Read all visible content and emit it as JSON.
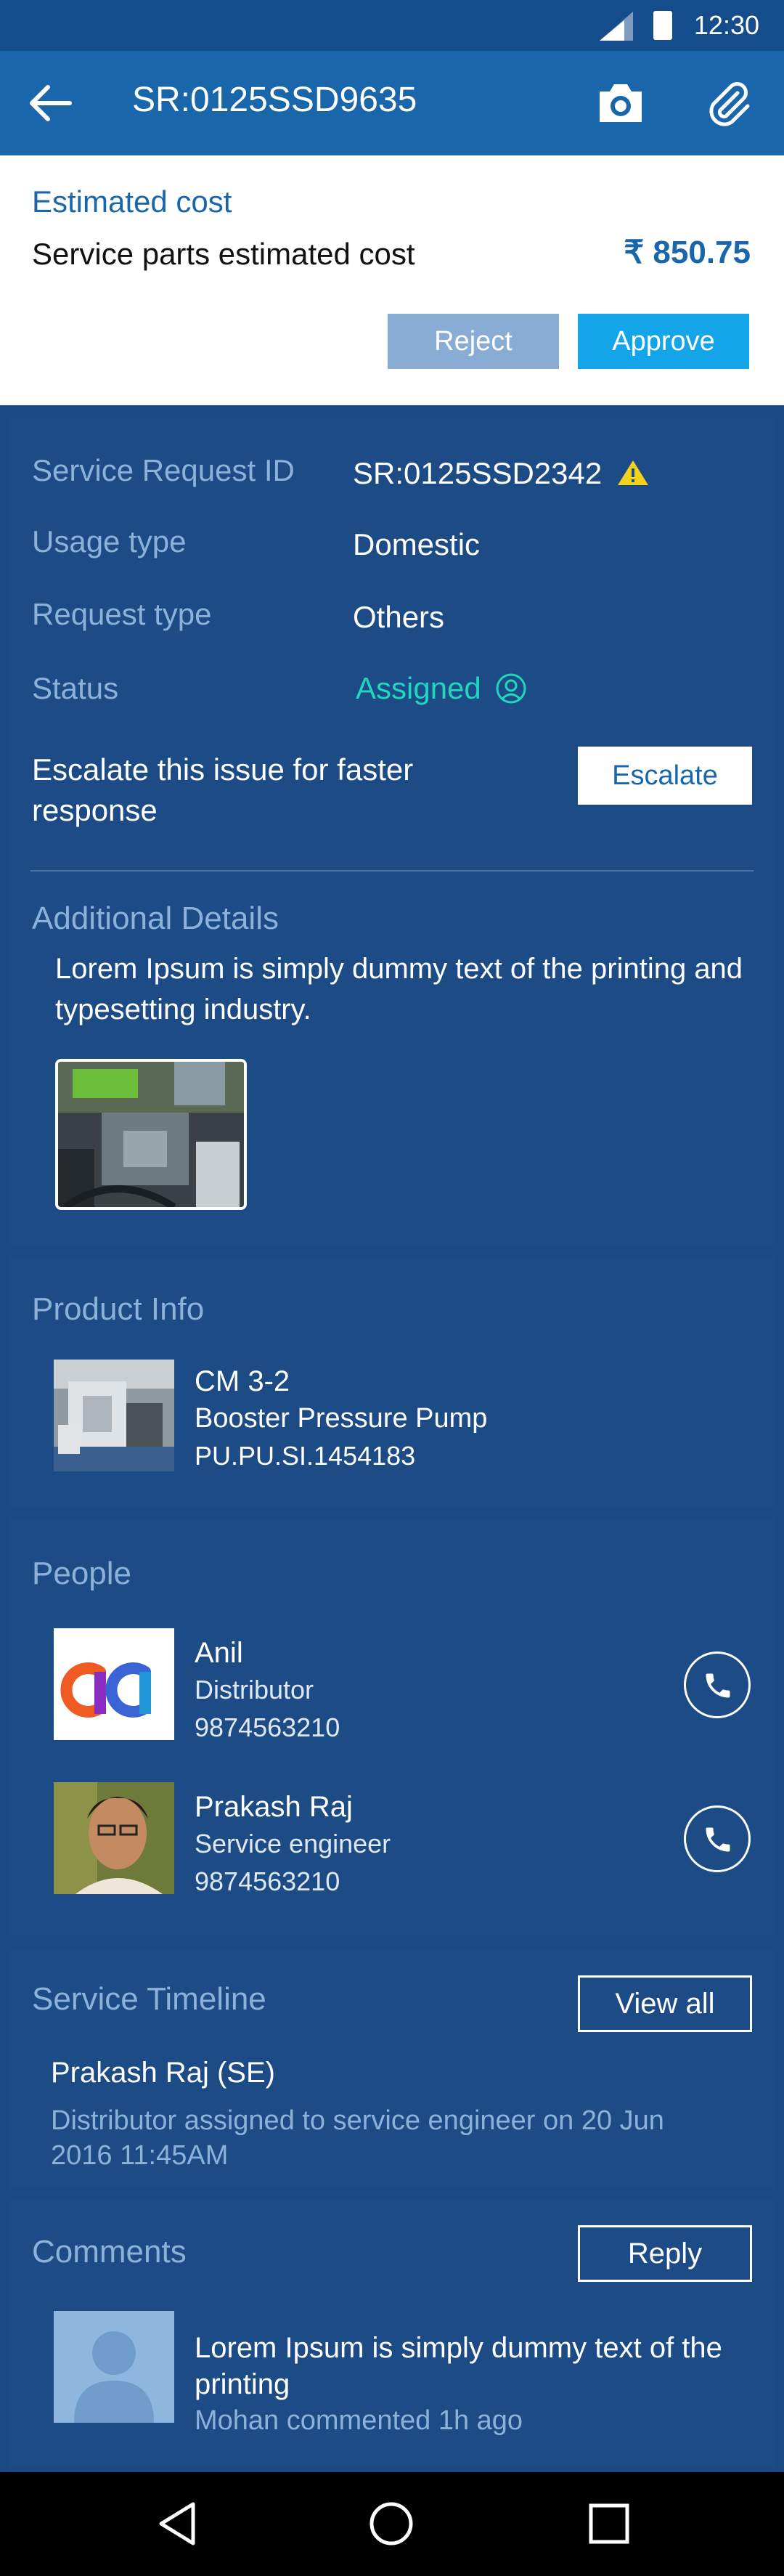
{
  "status_bar": {
    "time": "12:30"
  },
  "app_bar": {
    "title": "SR:0125SSD9635"
  },
  "estimated_cost": {
    "label": "Estimated cost",
    "description": "Service parts estimated cost",
    "amount": "₹ 850.75",
    "reject_label": "Reject",
    "approve_label": "Approve"
  },
  "details": {
    "fields": [
      {
        "key": "Service Request ID",
        "value": "SR:0125SSD2342"
      },
      {
        "key": "Usage type",
        "value": "Domestic"
      },
      {
        "key": "Request type",
        "value": "Others"
      },
      {
        "key": "Status",
        "value": "Assigned"
      }
    ],
    "escalate_text": "Escalate this issue for faster response",
    "escalate_label": "Escalate",
    "additional_title": "Additional Details",
    "additional_text": "Lorem Ipsum is simply dummy text of the printing and typesetting industry."
  },
  "product": {
    "title": "Product Info",
    "model": "CM 3-2",
    "name": "Booster Pressure Pump",
    "serial": "PU.PU.SI.1454183"
  },
  "people": {
    "title": "People",
    "items": [
      {
        "name": "Anil",
        "role": "Distributor",
        "phone": "9874563210"
      },
      {
        "name": "Prakash Raj",
        "role": "Service engineer",
        "phone": "9874563210"
      }
    ]
  },
  "timeline": {
    "title": "Service Timeline",
    "view_all_label": "View all",
    "entry_name": "Prakash Raj (SE)",
    "entry_desc": "Distributor assigned to service engineer on 20 Jun 2016 11:45AM"
  },
  "comments": {
    "title": "Comments",
    "reply_label": "Reply",
    "text": "Lorem Ipsum is simply dummy text of the printing",
    "meta": "Mohan commented 1h ago"
  },
  "colors": {
    "primary": "#1a66aa",
    "background": "#1a4a84",
    "accent": "#14a4e8",
    "assigned": "#20d6be",
    "warning": "#f2d21b"
  },
  "icons": [
    "back-arrow-icon",
    "camera-icon",
    "paperclip-icon",
    "warning-icon",
    "agent-icon",
    "phone-icon",
    "nav-back-icon",
    "nav-home-icon",
    "nav-recents-icon"
  ]
}
